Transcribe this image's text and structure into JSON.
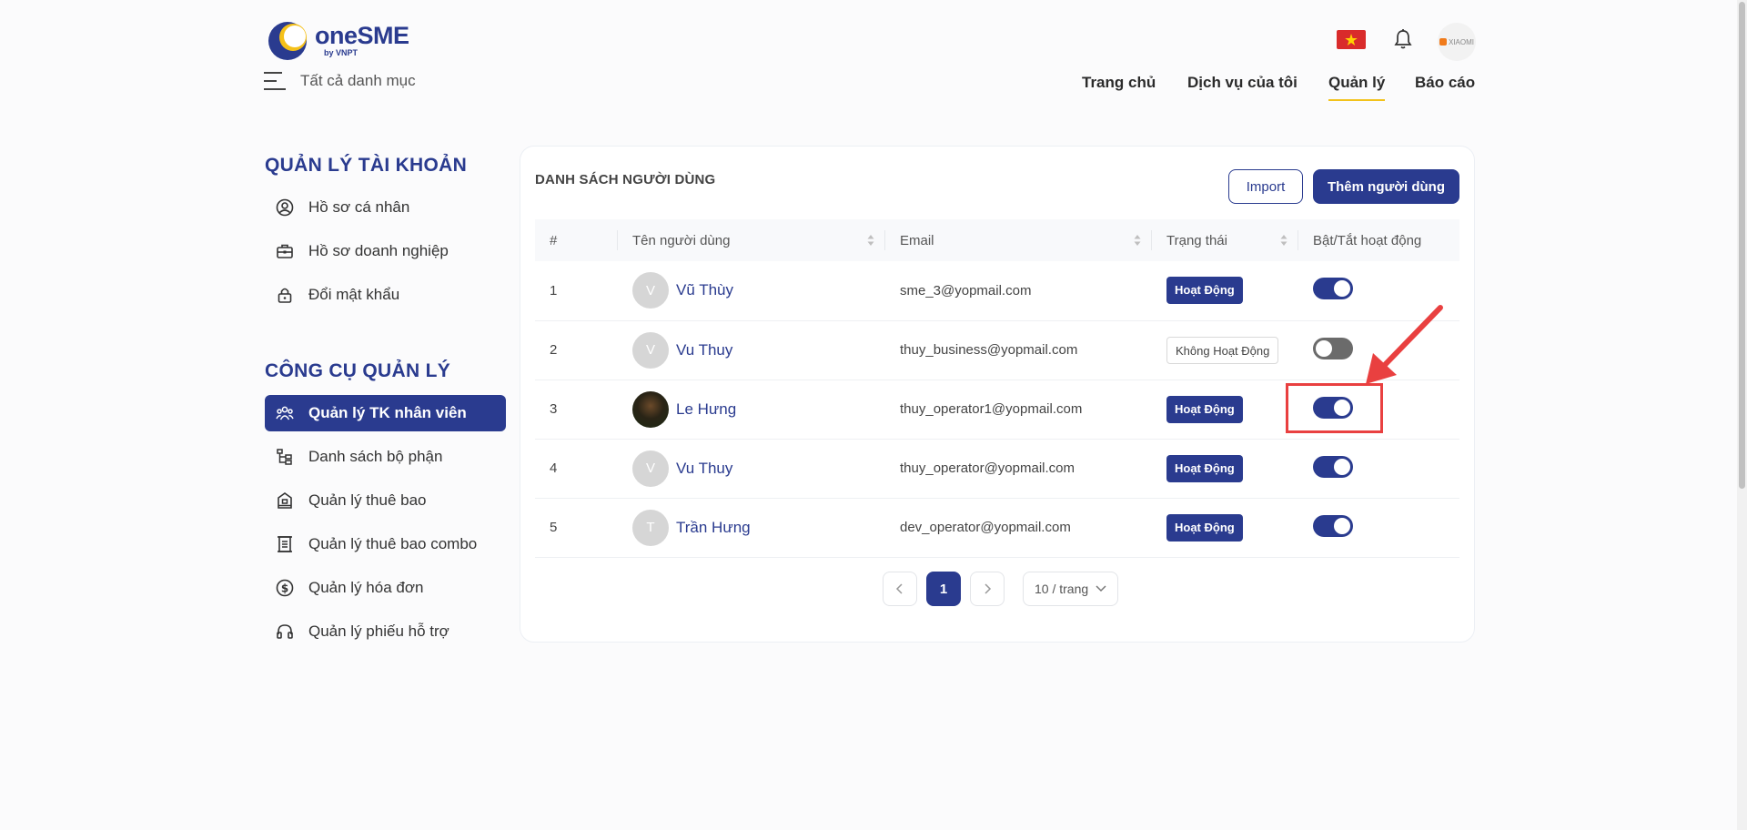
{
  "header": {
    "brand": {
      "name": "oneSME",
      "sub": "by VNPT"
    },
    "menu_label": "Tất cả danh mục",
    "avatar_text": "XIAOMI",
    "nav": [
      {
        "label": "Trang chủ"
      },
      {
        "label": "Dịch vụ của tôi"
      },
      {
        "label": "Quản lý",
        "active": true
      },
      {
        "label": "Báo cáo"
      }
    ]
  },
  "sidebar": {
    "account_title": "QUẢN LÝ TÀI KHOẢN",
    "account_items": [
      {
        "label": "Hồ sơ cá nhân",
        "icon": "user-circle-icon"
      },
      {
        "label": "Hồ sơ doanh nghiệp",
        "icon": "briefcase-icon"
      },
      {
        "label": "Đổi mật khẩu",
        "icon": "lock-icon"
      }
    ],
    "tools_title": "CÔNG CỤ QUẢN LÝ",
    "tools_items": [
      {
        "label": "Quản lý TK nhân viên",
        "icon": "users-icon",
        "active": true
      },
      {
        "label": "Danh sách bộ phận",
        "icon": "tree-icon"
      },
      {
        "label": "Quản lý thuê bao",
        "icon": "building-icon"
      },
      {
        "label": "Quản lý thuê bao combo",
        "icon": "combo-icon"
      },
      {
        "label": "Quản lý hóa đơn",
        "icon": "dollar-icon"
      },
      {
        "label": "Quản lý phiếu hỗ trợ",
        "icon": "headset-icon"
      }
    ]
  },
  "panel": {
    "title": "DANH SÁCH NGƯỜI DÙNG",
    "import_label": "Import",
    "add_label": "Thêm người dùng",
    "columns": [
      "#",
      "Tên người dùng",
      "Email",
      "Trạng thái",
      "Bật/Tắt hoạt động"
    ],
    "rows": [
      {
        "index": "1",
        "initial": "V",
        "name": "Vũ Thùy",
        "email": "sme_3@yopmail.com",
        "status": "Hoạt Động",
        "active": true
      },
      {
        "index": "2",
        "initial": "V",
        "name": "Vu Thuy",
        "email": "thuy_business@yopmail.com",
        "status": "Không Hoạt Động",
        "active": false
      },
      {
        "index": "3",
        "initial": "",
        "name": "Le Hưng",
        "email": "thuy_operator1@yopmail.com",
        "status": "Hoạt Động",
        "active": true,
        "photo": true
      },
      {
        "index": "4",
        "initial": "V",
        "name": "Vu Thuy",
        "email": "thuy_operator@yopmail.com",
        "status": "Hoạt Động",
        "active": true
      },
      {
        "index": "5",
        "initial": "T",
        "name": "Trần Hưng",
        "email": "dev_operator@yopmail.com",
        "status": "Hoạt Động",
        "active": true
      }
    ],
    "pagination": {
      "current": "1",
      "page_size": "10 / trang"
    }
  },
  "colors": {
    "primary": "#2a3b8f",
    "accent": "#f2c21b",
    "annotation": "#e94040"
  }
}
